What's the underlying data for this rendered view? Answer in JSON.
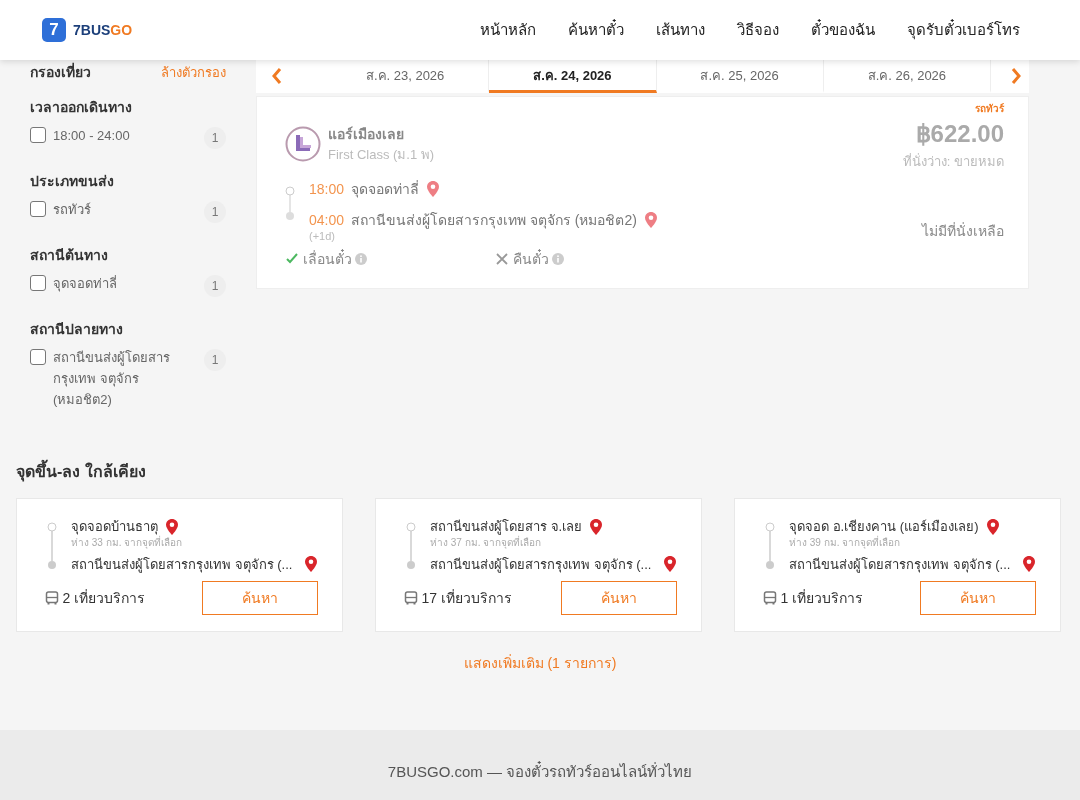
{
  "header": {
    "logo_mark": "7",
    "brand_main": "7BUS",
    "brand_accent": "GO",
    "nav": [
      "หน้าหลัก",
      "ค้นหาตั๋ว",
      "เส้นทาง",
      "วิธีจอง",
      "ตั๋วของฉัน",
      "จุดรับตั๋วเบอร์โทร"
    ]
  },
  "filters": {
    "title": "กรองเที่ยว",
    "clear": "ล้างตัวกรอง",
    "groups": [
      {
        "title": "เวลาออกเดินทาง",
        "items": [
          {
            "label": "18:00 - 24:00",
            "count": "1",
            "checked": false
          }
        ]
      },
      {
        "title": "ประเภทขนส่ง",
        "items": [
          {
            "label": "รถทัวร์",
            "count": "1",
            "checked": false
          }
        ]
      },
      {
        "title": "สถานีต้นทาง",
        "items": [
          {
            "label": "จุดจอดท่าลี่",
            "count": "1",
            "checked": false
          }
        ]
      },
      {
        "title": "สถานีปลายทาง",
        "items": [
          {
            "label": "สถานีขนส่งผู้โดยสารกรุงเทพ จตุจักร (หมอชิต2)",
            "count": "1",
            "checked": false
          }
        ]
      }
    ]
  },
  "dates": [
    {
      "label": "ส.ค. 23, 2026",
      "selected": false
    },
    {
      "label": "ส.ค. 24, 2026",
      "selected": true
    },
    {
      "label": "ส.ค. 25, 2026",
      "selected": false
    },
    {
      "label": "ส.ค. 26, 2026",
      "selected": false
    }
  ],
  "trip": {
    "type_tag": "รถทัวร์",
    "operator": "แอร์เมืองเลย",
    "class": "First Class (ม.1 พ)",
    "price": "฿622.00",
    "seats": "ที่นั่งว่าง: ขายหมด",
    "status": "ไม่มีที่นั่งเหลือ",
    "stops": [
      {
        "time": "18:00",
        "place": "จุดจอดท่าลี่"
      },
      {
        "time": "04:00",
        "place": "สถานีขนส่งผู้โดยสารกรุงเทพ จตุจักร (หมอชิต2)",
        "day_offset": "(+1d)"
      }
    ],
    "policies": [
      {
        "label": "เลื่อนตั๋ว",
        "allowed": true
      },
      {
        "label": "คืนตั๋ว",
        "allowed": false
      }
    ]
  },
  "nearby": {
    "title": "จุดขึ้น-ลง ใกล้เคียง",
    "cards": [
      {
        "from": "จุดจอดบ้านธาตุ",
        "distance": "ห่าง 33 กม. จากจุดที่เลือก",
        "to": "สถานีขนส่งผู้โดยสารกรุงเทพ จตุจักร (...",
        "trips": "2 เที่ยวบริการ",
        "button": "ค้นหา"
      },
      {
        "from": "สถานีขนส่งผู้โดยสาร จ.เลย",
        "distance": "ห่าง 37 กม. จากจุดที่เลือก",
        "to": "สถานีขนส่งผู้โดยสารกรุงเทพ จตุจักร (...",
        "trips": "17 เที่ยวบริการ",
        "button": "ค้นหา"
      },
      {
        "from": "จุดจอด อ.เชียงคาน (แอร์เมืองเลย)",
        "distance": "ห่าง 39 กม. จากจุดที่เลือก",
        "to": "สถานีขนส่งผู้โดยสารกรุงเทพ จตุจักร (...",
        "trips": "1 เที่ยวบริการ",
        "button": "ค้นหา"
      }
    ],
    "more": "แสดงเพิ่มเติม (1 รายการ)"
  },
  "footer": "7BUSGO.com — จองตั๋วรถทัวร์ออนไลน์ทั่วไทย"
}
